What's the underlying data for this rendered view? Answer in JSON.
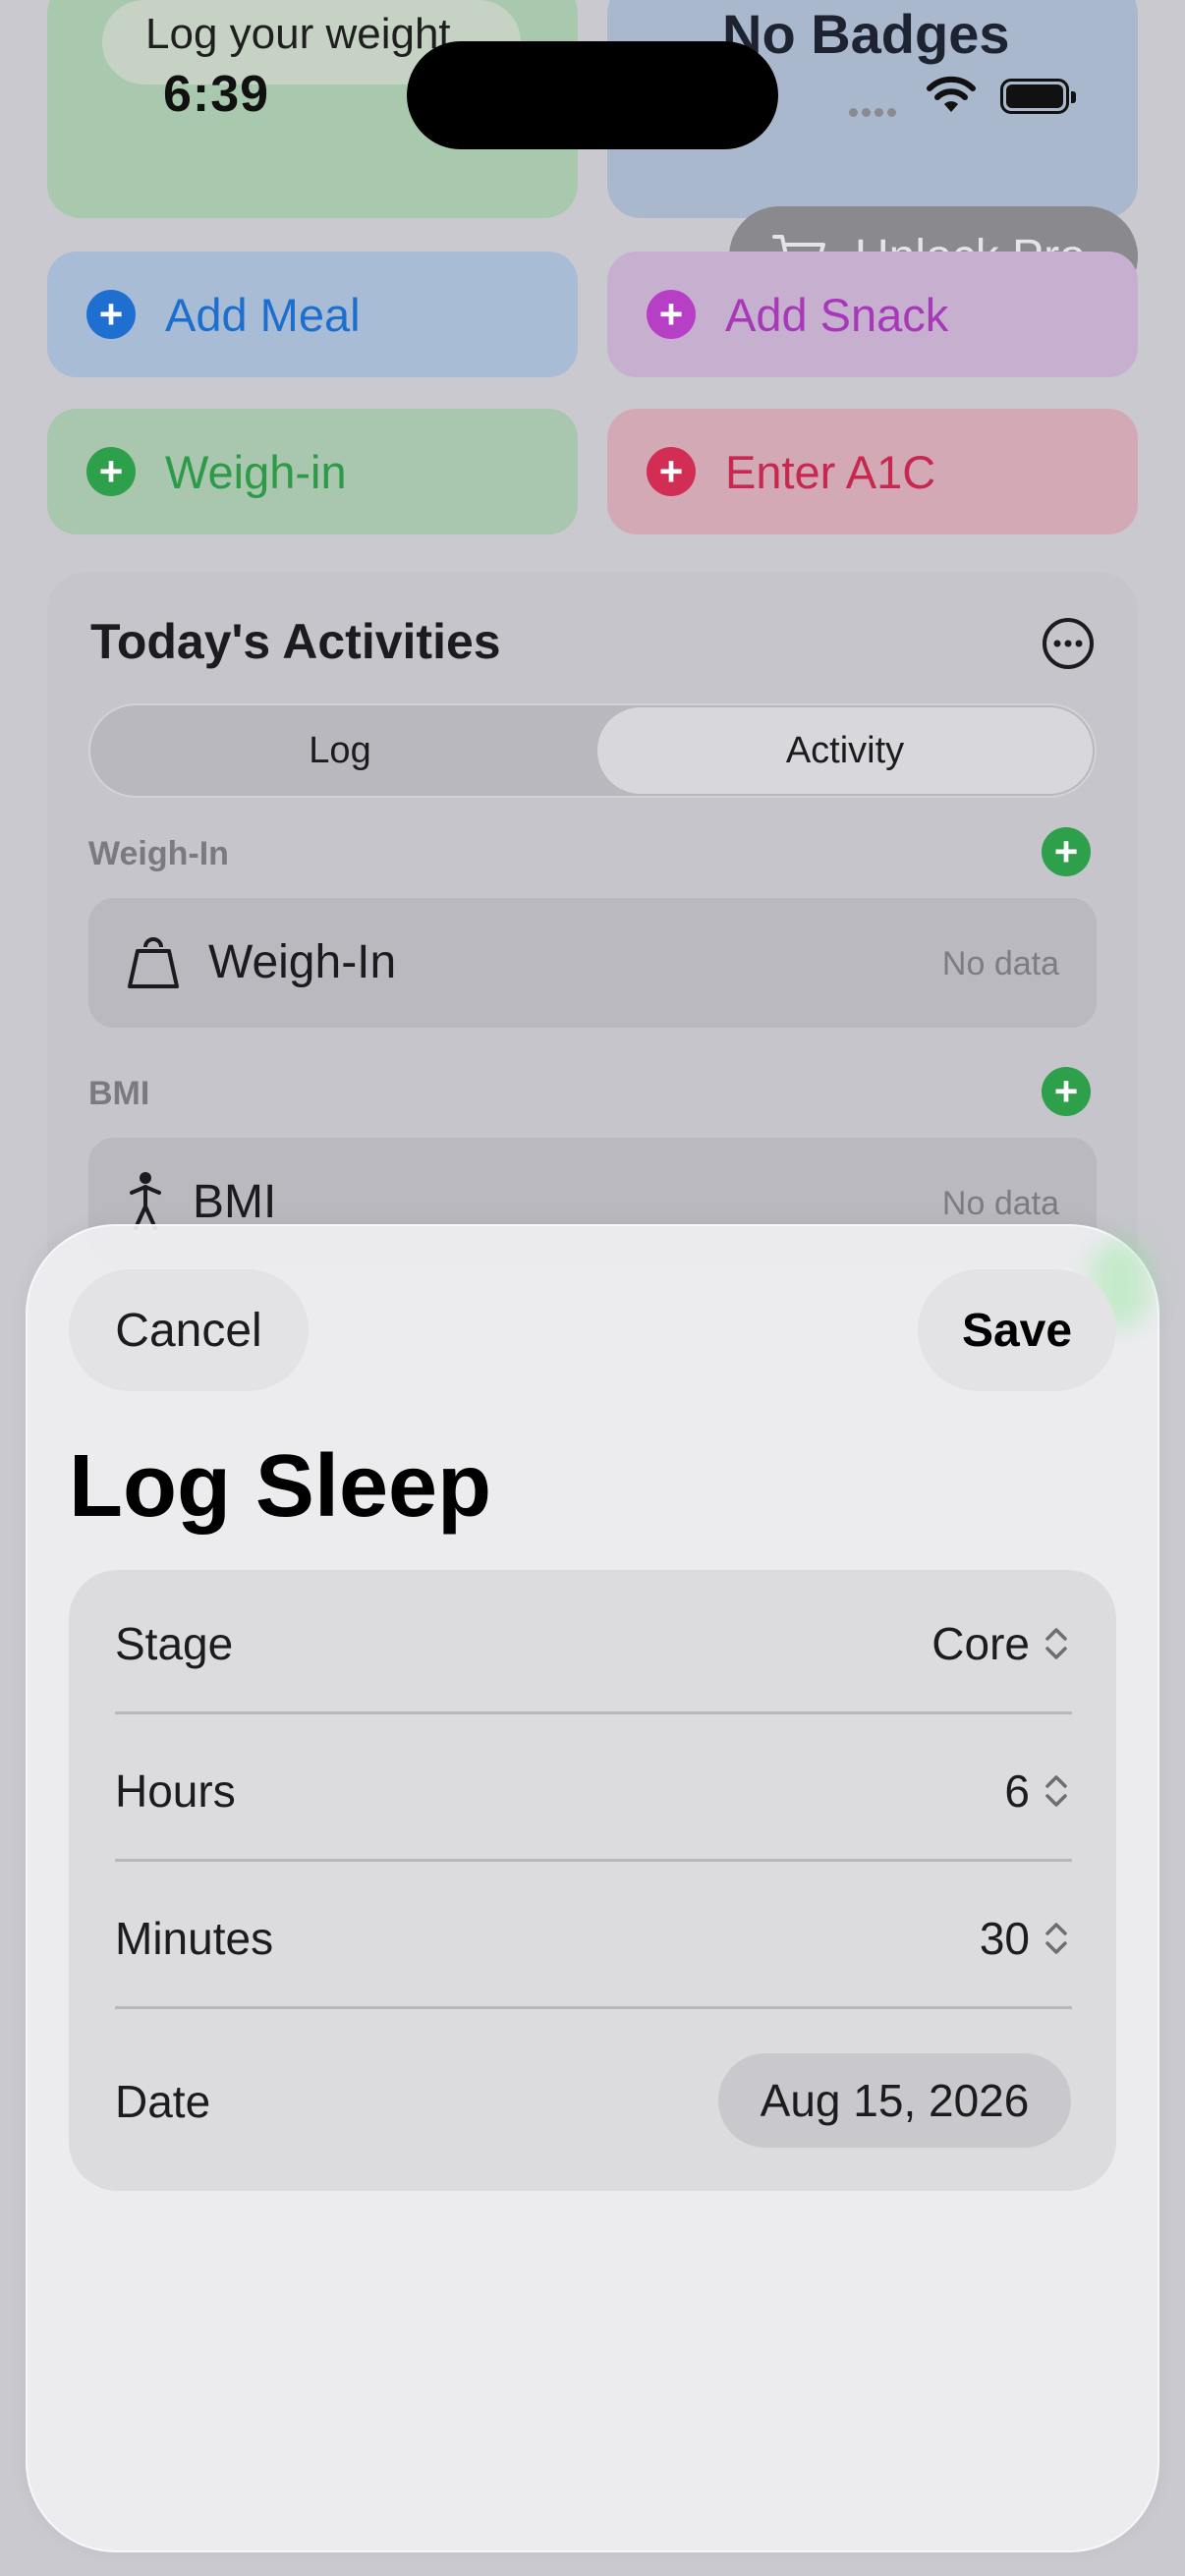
{
  "status_bar": {
    "time": "6:39",
    "icons": [
      "cellular-icon",
      "wifi-icon",
      "battery-icon"
    ]
  },
  "top_tiles": {
    "log_weight": "Log your weight",
    "badges": "No Badges"
  },
  "unlock_pro": {
    "label": "Unlock Pro",
    "icon": "cart-icon"
  },
  "quick_actions": {
    "add_meal": "Add Meal",
    "add_snack": "Add Snack",
    "weigh_in": "Weigh-in",
    "enter_a1c": "Enter A1C",
    "plus": "+"
  },
  "activities": {
    "title": "Today's Activities",
    "tabs": [
      {
        "label": "Log",
        "selected": false
      },
      {
        "label": "Activity",
        "selected": true
      }
    ],
    "sections": [
      {
        "label": "Weigh-In",
        "row_title": "Weigh-In",
        "row_value": "No data",
        "icon": "scale-icon"
      },
      {
        "label": "BMI",
        "row_title": "BMI",
        "row_value": "No data",
        "icon": "person-icon"
      }
    ]
  },
  "sheet": {
    "cancel": "Cancel",
    "save": "Save",
    "title": "Log Sleep",
    "fields": {
      "stage": {
        "label": "Stage",
        "value": "Core"
      },
      "hours": {
        "label": "Hours",
        "value": "6"
      },
      "minutes": {
        "label": "Minutes",
        "value": "30"
      },
      "date": {
        "label": "Date",
        "value": "Aug 15, 2026"
      }
    }
  },
  "colors": {
    "meal": "#1f6fd0",
    "snack": "#b63fc6",
    "weigh": "#2e9f4a",
    "a1c": "#d12d55"
  }
}
